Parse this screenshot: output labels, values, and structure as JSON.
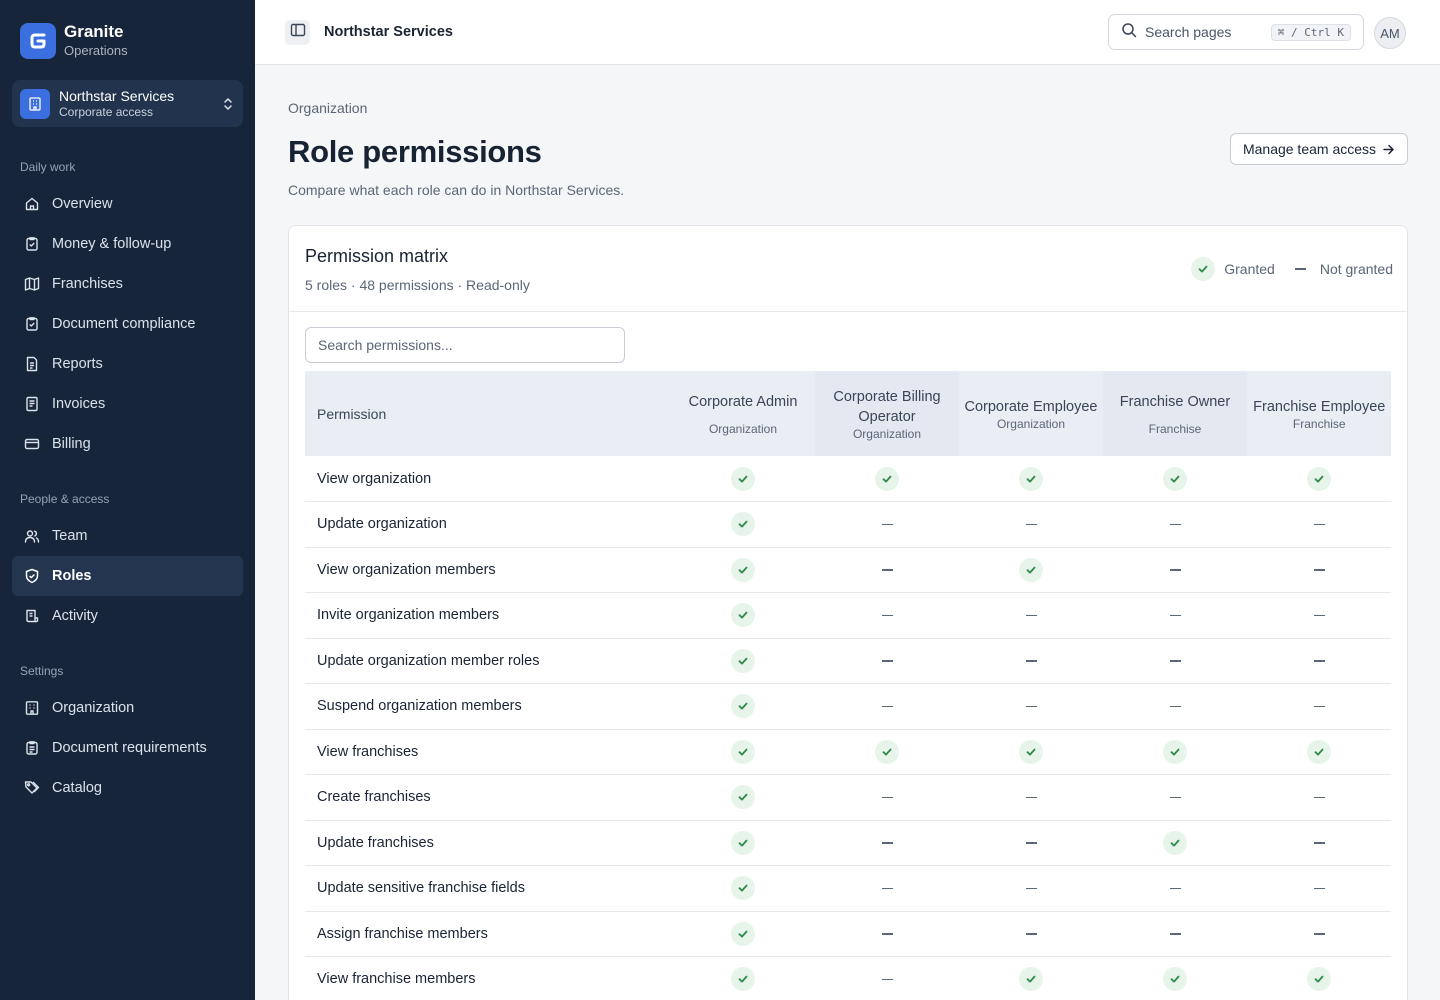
{
  "brand": {
    "name": "Granite",
    "subtitle": "Operations"
  },
  "org_switcher": {
    "name": "Northstar Services",
    "subtitle": "Corporate access"
  },
  "sidebar": {
    "sections": [
      {
        "label": "Daily work",
        "items": [
          "Overview",
          "Money & follow-up",
          "Franchises",
          "Document compliance",
          "Reports",
          "Invoices",
          "Billing"
        ]
      },
      {
        "label": "People & access",
        "items": [
          "Team",
          "Roles",
          "Activity"
        ]
      },
      {
        "label": "Settings",
        "items": [
          "Organization",
          "Document requirements",
          "Catalog"
        ]
      }
    ],
    "active_item": "Roles"
  },
  "topbar": {
    "title": "Northstar Services",
    "search_placeholder": "Search pages",
    "shortcut": "⌘ / Ctrl K",
    "avatar_initials": "AM"
  },
  "page": {
    "breadcrumb": "Organization",
    "title": "Role permissions",
    "subtitle": "Compare what each role can do in Northstar Services.",
    "manage_button": "Manage team access"
  },
  "matrix": {
    "title": "Permission matrix",
    "subtitle": "5 roles · 48 permissions · Read-only",
    "legend_granted": "Granted",
    "legend_not_granted": "Not granted",
    "search_placeholder": "Search permissions...",
    "permission_header": "Permission",
    "roles": [
      {
        "name": "Corporate Admin",
        "scope": "Organization"
      },
      {
        "name": "Corporate Billing Operator",
        "scope": "Organization"
      },
      {
        "name": "Corporate Employee",
        "scope": "Organization"
      },
      {
        "name": "Franchise Owner",
        "scope": "Franchise"
      },
      {
        "name": "Franchise Employee",
        "scope": "Franchise"
      }
    ],
    "rows": [
      {
        "permission": "View organization",
        "grants": [
          true,
          true,
          true,
          true,
          true
        ]
      },
      {
        "permission": "Update organization",
        "grants": [
          true,
          false,
          false,
          false,
          false
        ]
      },
      {
        "permission": "View organization members",
        "grants": [
          true,
          false,
          true,
          false,
          false
        ]
      },
      {
        "permission": "Invite organization members",
        "grants": [
          true,
          false,
          false,
          false,
          false
        ]
      },
      {
        "permission": "Update organization member roles",
        "grants": [
          true,
          false,
          false,
          false,
          false
        ]
      },
      {
        "permission": "Suspend organization members",
        "grants": [
          true,
          false,
          false,
          false,
          false
        ]
      },
      {
        "permission": "View franchises",
        "grants": [
          true,
          true,
          true,
          true,
          true
        ]
      },
      {
        "permission": "Create franchises",
        "grants": [
          true,
          false,
          false,
          false,
          false
        ]
      },
      {
        "permission": "Update franchises",
        "grants": [
          true,
          false,
          false,
          true,
          false
        ]
      },
      {
        "permission": "Update sensitive franchise fields",
        "grants": [
          true,
          false,
          false,
          false,
          false
        ]
      },
      {
        "permission": "Assign franchise members",
        "grants": [
          true,
          false,
          false,
          false,
          false
        ]
      },
      {
        "permission": "View franchise members",
        "grants": [
          true,
          false,
          true,
          true,
          true
        ]
      }
    ]
  },
  "colors": {
    "sidebar_bg": "#17253a",
    "accent": "#3b6fe0",
    "granted_bg": "#e6f4ea",
    "granted_check": "#2f8a4a"
  }
}
